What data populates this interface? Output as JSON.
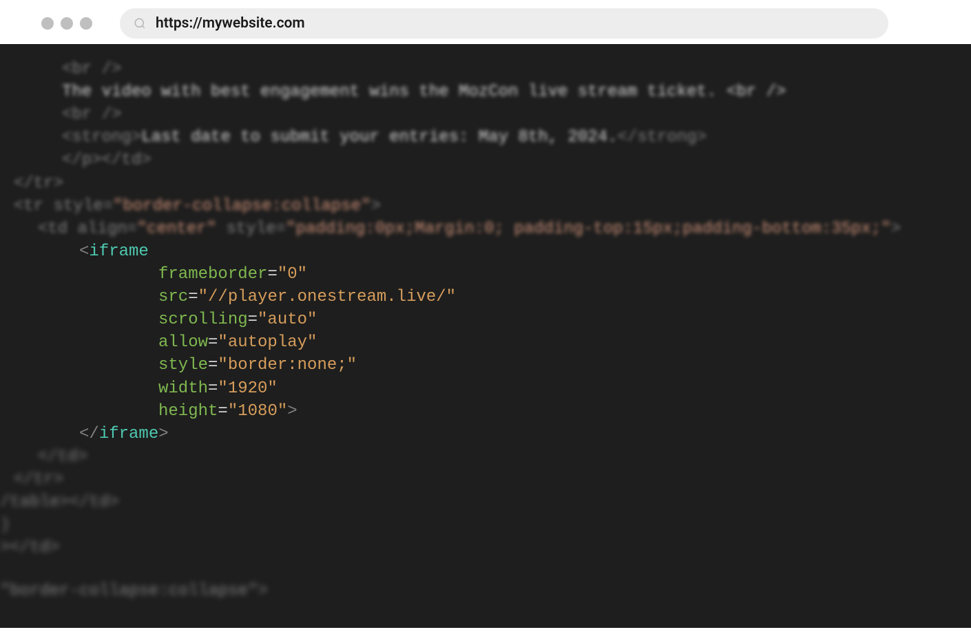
{
  "browser": {
    "url": "https://mywebsite.com"
  },
  "code": {
    "blurred_top": {
      "line1": "<br />",
      "line2": "The video with best engagement wins the MozCon live stream ticket. <br />",
      "line3": "<br />",
      "line4_open": "<strong>",
      "line4_text": "Last date to submit your entries: May 8th, 2024.",
      "line4_close": "</strong>",
      "line5": "</p></td>",
      "line6": "</tr>",
      "line7_open": "<tr style=",
      "line7_val": "\"border-collapse:collapse\"",
      "line7_close": ">",
      "line8_open": "<td align=",
      "line8_val1": "\"center\"",
      "line8_mid": " style=",
      "line8_val2": "\"padding:0px;Margin:0; padding-top:15px;padding-bottom:35px;\"",
      "line8_close": ">"
    },
    "focused": {
      "iframe_open": "<iframe",
      "attr1_name": "frameborder",
      "attr1_val": "\"0\"",
      "attr2_name": "src",
      "attr2_val": "\"//player.onestream.live/\"",
      "attr3_name": "scrolling",
      "attr3_val": "\"auto\"",
      "attr4_name": "allow",
      "attr4_val": "\"autoplay\"",
      "attr5_name": "style",
      "attr5_val": "\"border:none;\"",
      "attr6_name": "width",
      "attr6_val": "\"1920\"",
      "attr7_name": "height",
      "attr7_val": "\"1080\"",
      "iframe_close_bracket": ">",
      "iframe_close": "</iframe>"
    },
    "blurred_bottom": {
      "line1": "</td>",
      "line2": "</tr>",
      "line3": "/table></td>",
      "line4": ")",
      "line5": "></td>",
      "line6": "\"border-collapse:collapse\">"
    }
  }
}
